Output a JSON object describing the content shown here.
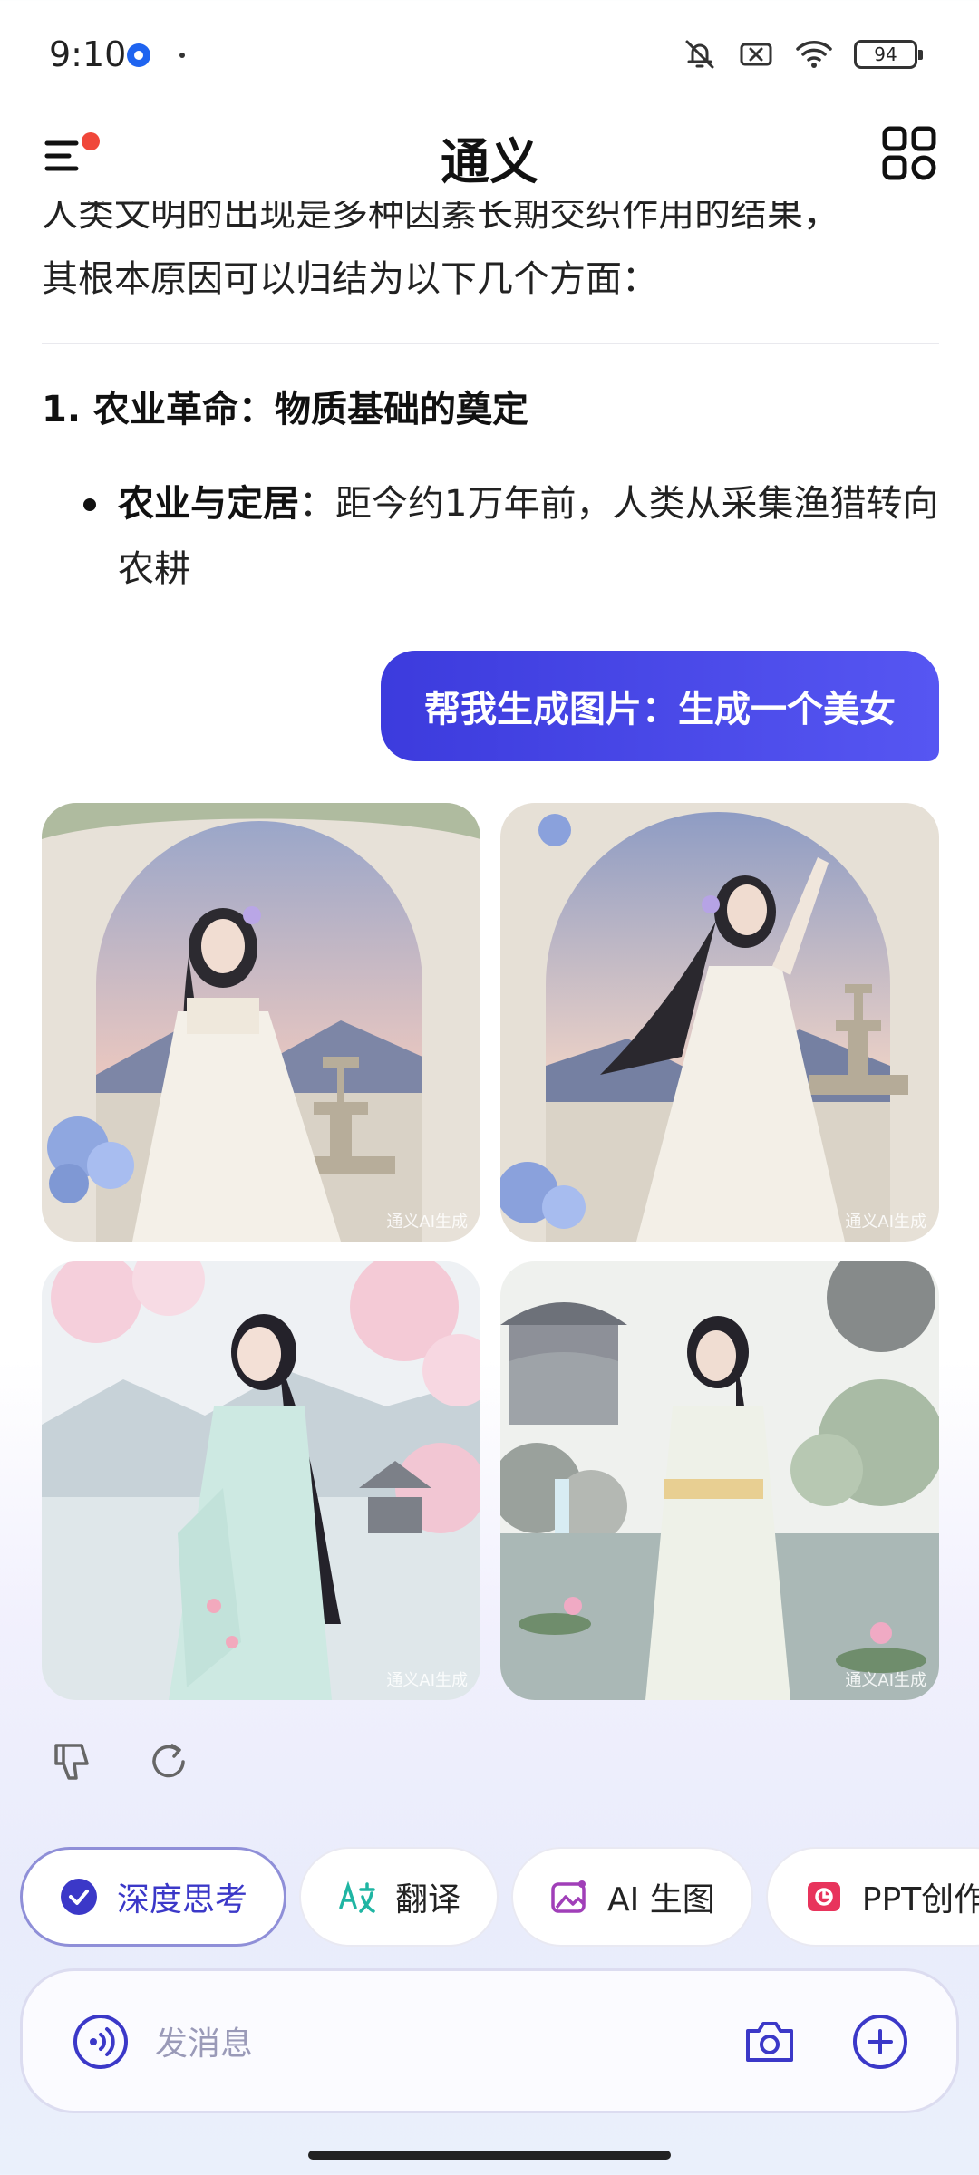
{
  "status_bar": {
    "time": "9:10",
    "battery": "94",
    "icons": [
      "bell-off-icon",
      "x-box-icon",
      "wifi-icon",
      "battery-icon"
    ]
  },
  "header": {
    "title": "通义",
    "menu_icon": "menu-icon",
    "apps_icon": "apps-grid-icon",
    "notification_color": "#f0473a"
  },
  "answer": {
    "clipped_line": "人类文明的出现是多种因素长期交织作用的结果，",
    "intro_line": "其根本原因可以归结为以下几个方面：",
    "heading": "1. 农业革命：物质基础的奠定",
    "bullet_bold": "农业与定居",
    "bullet_text": "：距今约1万年前，人类从采集渔猎转向农耕"
  },
  "user_message": {
    "text": "帮我生成图片：生成一个美女",
    "color_start": "#3c3bdd",
    "color_end": "#5656f2"
  },
  "images": {
    "watermark": "通义AI生成",
    "items": [
      "garden-portrait-1",
      "garden-portrait-2",
      "cherry-blossom-portrait",
      "pavilion-portrait"
    ]
  },
  "feedback": {
    "dislike_icon": "thumbs-down-icon",
    "regenerate_icon": "refresh-icon"
  },
  "chips": [
    {
      "label": "深度思考",
      "icon": "check-circle-icon",
      "active": true
    },
    {
      "label": "翻译",
      "icon": "translate-icon",
      "active": false
    },
    {
      "label": "AI 生图",
      "icon": "image-gen-icon",
      "active": false
    },
    {
      "label": "PPT创作",
      "icon": "ppt-icon",
      "active": false
    }
  ],
  "input": {
    "placeholder": "发消息",
    "voice_icon": "voice-icon",
    "camera_icon": "camera-icon",
    "plus_icon": "plus-circle-icon",
    "accent": "#3b38c8"
  }
}
